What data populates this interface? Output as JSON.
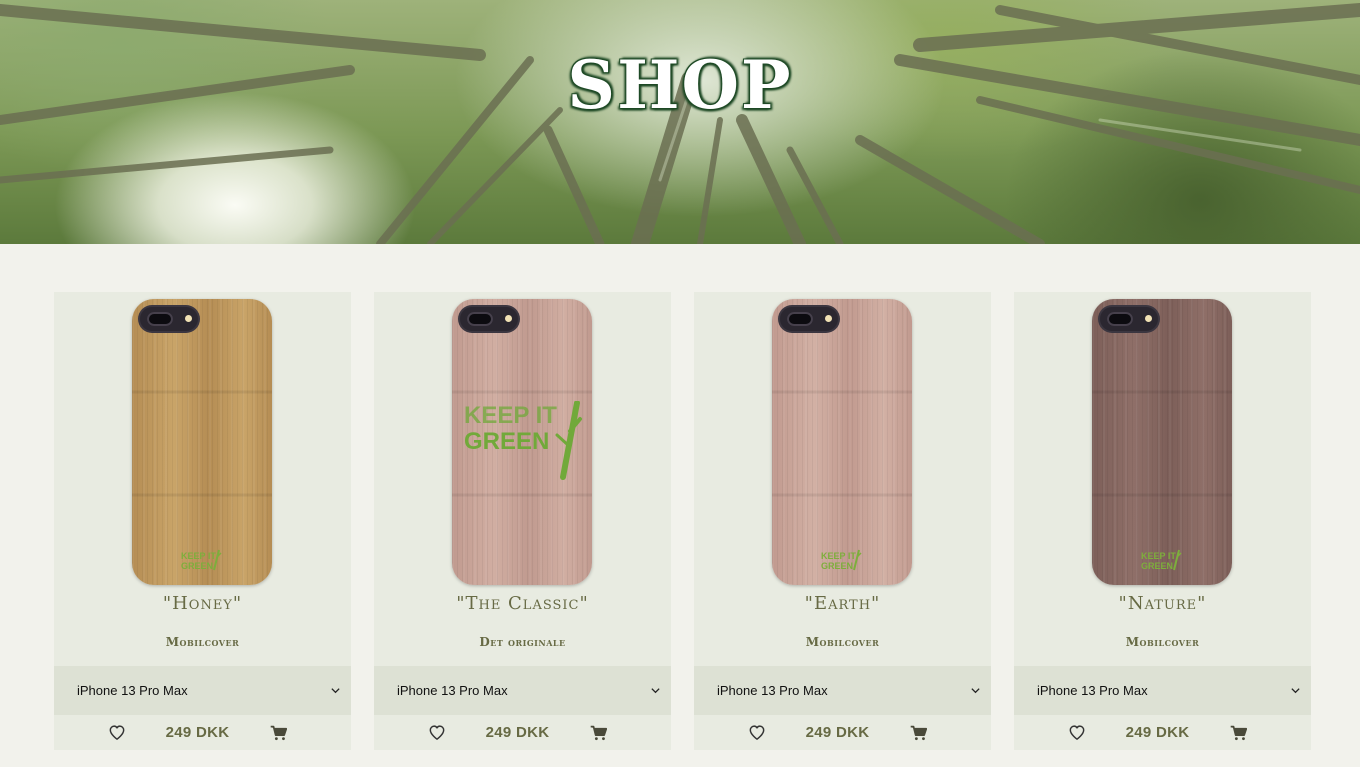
{
  "hero": {
    "title": "SHOP"
  },
  "products": [
    {
      "name": "\"Honey\"",
      "subtitle": "Mobilcover",
      "model": "iPhone 13 Pro Max",
      "price": "249 DKK",
      "wood_color": "#b58d54",
      "wood_color_2": "#c9a468",
      "logo": "small"
    },
    {
      "name": "\"The Classic\"",
      "subtitle": "Det originale",
      "model": "iPhone 13 Pro Max",
      "price": "249 DKK",
      "wood_color": "#c09a8f",
      "wood_color_2": "#d1aea2",
      "logo": "big"
    },
    {
      "name": "\"Earth\"",
      "subtitle": "Mobilcover",
      "model": "iPhone 13 Pro Max",
      "price": "249 DKK",
      "wood_color": "#c19a8f",
      "wood_color_2": "#d2b0a4",
      "logo": "small"
    },
    {
      "name": "\"Nature\"",
      "subtitle": "Mobilcover",
      "model": "iPhone 13 Pro Max",
      "price": "249 DKK",
      "wood_color": "#7d5f59",
      "wood_color_2": "#8f6f68",
      "logo": "small"
    }
  ],
  "logo_text": {
    "line1": "KEEP IT",
    "line2": "GREEN"
  },
  "icons": {
    "favorite": "heart-icon",
    "cart": "cart-icon",
    "dropdown": "chevron-down-icon"
  },
  "colors": {
    "accent_text": "#676a44",
    "logo_green": "#71a93a"
  }
}
